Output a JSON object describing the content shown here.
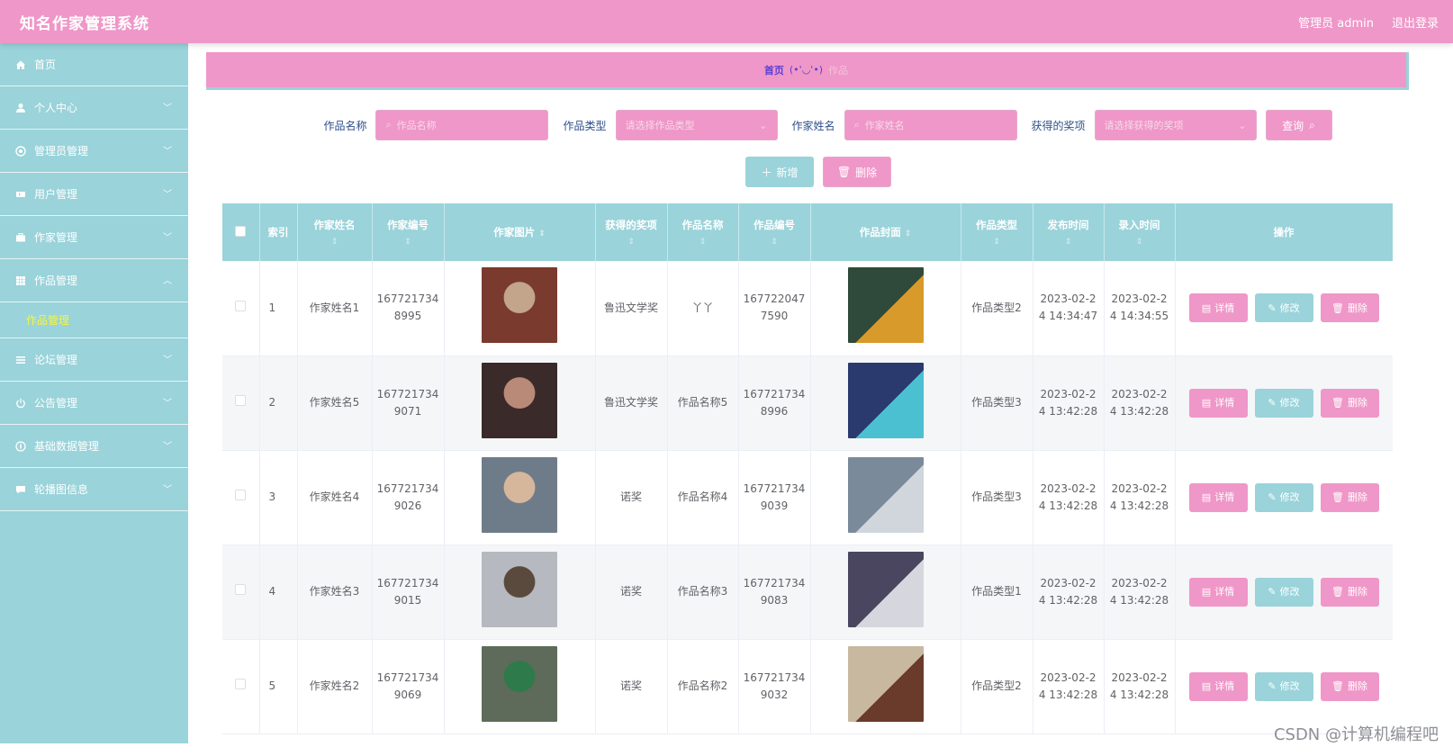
{
  "app": {
    "title": "知名作家管理系统",
    "user_label": "管理员 admin",
    "logout_label": "退出登录"
  },
  "colors": {
    "pink": "#ef97c8",
    "teal": "#9ad3da",
    "accent_purple": "#5b3fd6",
    "active_submenu": "#f5f542"
  },
  "sidebar": {
    "items": [
      {
        "label": "首页",
        "icon": "home-icon",
        "expandable": false
      },
      {
        "label": "个人中心",
        "icon": "user-icon",
        "expandable": true
      },
      {
        "label": "管理员管理",
        "icon": "settings-icon",
        "expandable": true
      },
      {
        "label": "用户管理",
        "icon": "ticket-icon",
        "expandable": true
      },
      {
        "label": "作家管理",
        "icon": "briefcase-icon",
        "expandable": true
      },
      {
        "label": "作品管理",
        "icon": "grid-icon",
        "expandable": true,
        "expanded": true
      },
      {
        "label": "论坛管理",
        "icon": "list-icon",
        "expandable": true
      },
      {
        "label": "公告管理",
        "icon": "power-icon",
        "expandable": true
      },
      {
        "label": "基础数据管理",
        "icon": "compass-icon",
        "expandable": true
      },
      {
        "label": "轮播图信息",
        "icon": "chat-icon",
        "expandable": true
      }
    ],
    "active_submenu": "作品管理"
  },
  "breadcrumb": {
    "home": "首页",
    "separator": "(•'◡'•)",
    "current": "作品"
  },
  "search": {
    "fields": [
      {
        "label": "作品名称",
        "placeholder": "作品名称",
        "kind": "input"
      },
      {
        "label": "作品类型",
        "placeholder": "请选择作品类型",
        "kind": "select"
      },
      {
        "label": "作家姓名",
        "placeholder": "作家姓名",
        "kind": "input"
      },
      {
        "label": "获得的奖项",
        "placeholder": "请选择获得的奖项",
        "kind": "select"
      }
    ],
    "query_label": "查询"
  },
  "actions": {
    "add_label": "新增",
    "delete_label": "删除"
  },
  "table": {
    "headers": [
      "索引",
      "作家姓名",
      "作家编号",
      "作家图片",
      "获得的奖项",
      "作品名称",
      "作品编号",
      "作品封面",
      "作品类型",
      "发布时间",
      "录入时间",
      "操作"
    ],
    "op_labels": {
      "detail": "详情",
      "edit": "修改",
      "delete": "删除"
    },
    "rows": [
      {
        "index": "1",
        "writer_name": "作家姓名1",
        "writer_no": "1677217348995",
        "award": "鲁迅文学奖",
        "work_name": "丫丫",
        "work_no": "1677220477590",
        "work_type": "作品类型2",
        "publish_time": "2023-02-24 14:34:47",
        "entry_time": "2023-02-24 14:34:55"
      },
      {
        "index": "2",
        "writer_name": "作家姓名5",
        "writer_no": "1677217349071",
        "award": "鲁迅文学奖",
        "work_name": "作品名称5",
        "work_no": "1677217348996",
        "work_type": "作品类型3",
        "publish_time": "2023-02-24 13:42:28",
        "entry_time": "2023-02-24 13:42:28"
      },
      {
        "index": "3",
        "writer_name": "作家姓名4",
        "writer_no": "1677217349026",
        "award": "诺奖",
        "work_name": "作品名称4",
        "work_no": "1677217349039",
        "work_type": "作品类型3",
        "publish_time": "2023-02-24 13:42:28",
        "entry_time": "2023-02-24 13:42:28"
      },
      {
        "index": "4",
        "writer_name": "作家姓名3",
        "writer_no": "1677217349015",
        "award": "诺奖",
        "work_name": "作品名称3",
        "work_no": "1677217349083",
        "work_type": "作品类型1",
        "publish_time": "2023-02-24 13:42:28",
        "entry_time": "2023-02-24 13:42:28"
      },
      {
        "index": "5",
        "writer_name": "作家姓名2",
        "writer_no": "1677217349069",
        "award": "诺奖",
        "work_name": "作品名称2",
        "work_no": "1677217349032",
        "work_type": "作品类型2",
        "publish_time": "2023-02-24 13:42:28",
        "entry_time": "2023-02-24 13:42:28"
      }
    ]
  },
  "watermark": "CSDN @计算机编程吧"
}
